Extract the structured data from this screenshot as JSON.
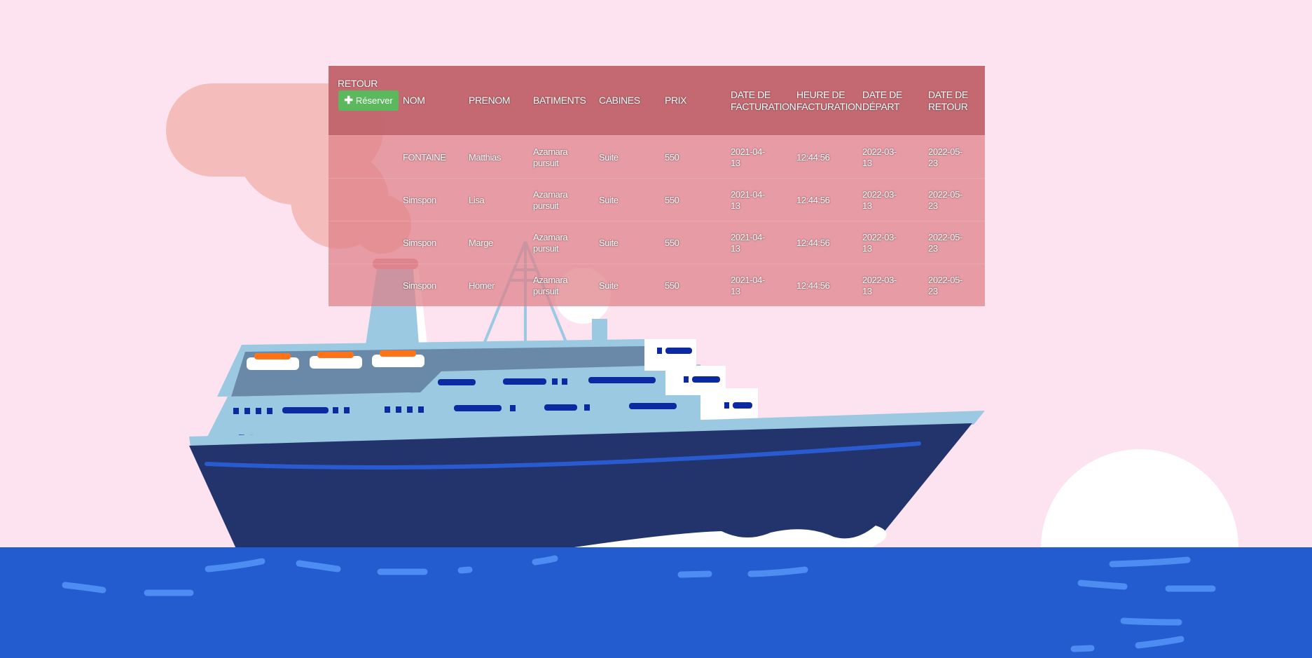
{
  "nav": {
    "back_label": "RETOUR"
  },
  "actions": {
    "reserve_label": "Réserver"
  },
  "table": {
    "headers": [
      "NOM",
      "PRENOM",
      "BATIMENTS",
      "CABINES",
      "PRIX",
      "DATE DE FACTURATION",
      "HEURE DE FACTURATION",
      "DATE DE DÉPART",
      "DATE DE RETOUR"
    ],
    "rows": [
      [
        "FONTAINE",
        "Matthias",
        "Azamara pursuit",
        "Suite",
        "550",
        "2021-04-13",
        "12:44:56",
        "2022-03-13",
        "2022-05-23"
      ],
      [
        "Simspon",
        "Lisa",
        "Azamara pursuit",
        "Suite",
        "550",
        "2021-04-13",
        "12:44:56",
        "2022-03-13",
        "2022-05-23"
      ],
      [
        "Simspon",
        "Marge",
        "Azamara pursuit",
        "Suite",
        "550",
        "2021-04-13",
        "12:44:56",
        "2022-03-13",
        "2022-05-23"
      ],
      [
        "Simspon",
        "Homer",
        "Azamara pursuit",
        "Suite",
        "550",
        "2021-04-13",
        "12:44:56",
        "2022-03-13",
        "2022-05-23"
      ]
    ]
  },
  "colors": {
    "background": "#fde2f0",
    "sea": "#225ccf",
    "hull": "#22346b",
    "reserve_button": "#5cb85c",
    "table_header": "#c0646c",
    "table_body": "#de8086"
  }
}
